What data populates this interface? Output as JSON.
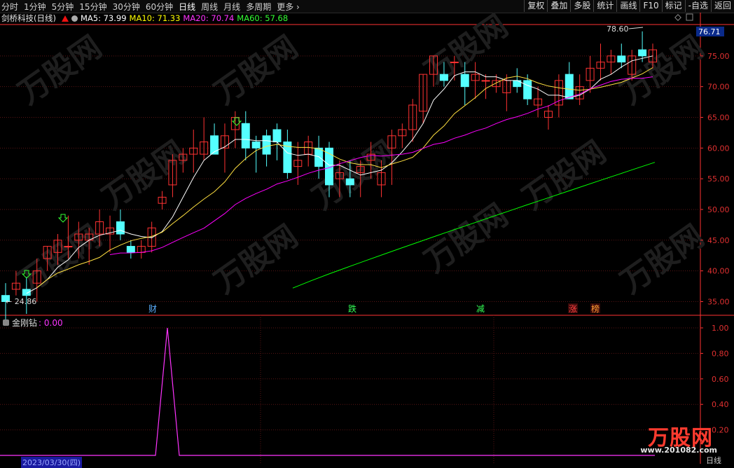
{
  "toolbar": {
    "periods": [
      "分时",
      "1分钟",
      "5分钟",
      "15分钟",
      "30分钟",
      "60分钟",
      "日线",
      "周线",
      "月线",
      "多周期",
      "更多"
    ],
    "active_period": "日线",
    "right_buttons": [
      "复权",
      "叠加",
      "多股",
      "统计",
      "画线",
      "F10",
      "标记",
      "-自选",
      "返回"
    ]
  },
  "stock": {
    "name": "剑桥科技(日线)",
    "ma5": "MA5: 73.99",
    "ma10": "MA10: 71.33",
    "ma20": "MA20: 70.74",
    "ma60": "MA60: 57.68"
  },
  "colors": {
    "up": "#ff3232",
    "down": "#54ffff",
    "ma5": "#ffffff",
    "ma10": "#ffff00",
    "ma20": "#ff00ff",
    "ma60": "#00ff00",
    "axis": "#ff3232",
    "grid": "#5a1414"
  },
  "price_axis": {
    "ticks": [
      "75.00",
      "70.00",
      "65.00",
      "60.00",
      "55.00",
      "50.00",
      "45.00",
      "40.00",
      "35.00"
    ],
    "current": "76.71"
  },
  "annotations": {
    "high": "78.60",
    "low": "24.86",
    "events": [
      "财",
      "跌",
      "减",
      "涨",
      "榜"
    ]
  },
  "indicator": {
    "name": "金刚钻",
    "value": ": 0.00",
    "ticks": [
      "1.00",
      "0.80",
      "0.60",
      "0.40",
      "0.20"
    ]
  },
  "footer": {
    "date": "2023/03/30(四)",
    "right": "日线"
  },
  "watermark": {
    "brand": "万股网",
    "url": "www.201082.com"
  },
  "chart_data": {
    "type": "candlestick",
    "ylim": [
      33,
      80
    ],
    "candles": [
      [
        36,
        38,
        32,
        35
      ],
      [
        37,
        40,
        36,
        38
      ],
      [
        37,
        39,
        33,
        36
      ],
      [
        38,
        42,
        35,
        40
      ],
      [
        42,
        44,
        40,
        44
      ],
      [
        43,
        46,
        41,
        45
      ],
      [
        44,
        49,
        42,
        44
      ],
      [
        45,
        48,
        42,
        46
      ],
      [
        45,
        47,
        41,
        46
      ],
      [
        46,
        50,
        44,
        48
      ],
      [
        46,
        49,
        43,
        47
      ],
      [
        48,
        50,
        45,
        46
      ],
      [
        44,
        45,
        42,
        43
      ],
      [
        43,
        45,
        42,
        44
      ],
      [
        44,
        48,
        43,
        47
      ],
      [
        51,
        53,
        50,
        52
      ],
      [
        54,
        59,
        52,
        58
      ],
      [
        58,
        60,
        56,
        59
      ],
      [
        59,
        63,
        56,
        60
      ],
      [
        59,
        65,
        58,
        61
      ],
      [
        62,
        64,
        59,
        59
      ],
      [
        60,
        64,
        56,
        62
      ],
      [
        63,
        66,
        60,
        65
      ],
      [
        64,
        66,
        58,
        60
      ],
      [
        61,
        62,
        56,
        60
      ],
      [
        62,
        63,
        57,
        59
      ],
      [
        63,
        64,
        58,
        61
      ],
      [
        61,
        63,
        55,
        56
      ],
      [
        57,
        61,
        54,
        58
      ],
      [
        59,
        62,
        57,
        61
      ],
      [
        60,
        62,
        55,
        57
      ],
      [
        60,
        61,
        52,
        54
      ],
      [
        55,
        58,
        52,
        56
      ],
      [
        55,
        58,
        52,
        54
      ],
      [
        56,
        58,
        52,
        57
      ],
      [
        58,
        61,
        55,
        59
      ],
      [
        54,
        58,
        52,
        56
      ],
      [
        60,
        63,
        54,
        62
      ],
      [
        62,
        64,
        60,
        63
      ],
      [
        63,
        68,
        61,
        67
      ],
      [
        66,
        72,
        64,
        72
      ],
      [
        72,
        75,
        70,
        75
      ],
      [
        72,
        74,
        70,
        71
      ],
      [
        74,
        75,
        71,
        74
      ],
      [
        72,
        74,
        67,
        70
      ],
      [
        71,
        74,
        68,
        72
      ],
      [
        71,
        72,
        68,
        71
      ],
      [
        70,
        72,
        69,
        71
      ],
      [
        69,
        72,
        66,
        71
      ],
      [
        71,
        73,
        69,
        70
      ],
      [
        71,
        72,
        67,
        68
      ],
      [
        67,
        70,
        65,
        68
      ],
      [
        65,
        67,
        63,
        66
      ],
      [
        67,
        72,
        65,
        71
      ],
      [
        72,
        74,
        68,
        68
      ],
      [
        68,
        72,
        67,
        70
      ],
      [
        71,
        75,
        69,
        73
      ],
      [
        73,
        77,
        71,
        74
      ],
      [
        74,
        76,
        72,
        75
      ],
      [
        75,
        77,
        73,
        74
      ],
      [
        72,
        76,
        71,
        75
      ],
      [
        76,
        79,
        74,
        75
      ],
      [
        74,
        77,
        73,
        76
      ]
    ],
    "ma60_start": 37.2,
    "ma60_end": 57.68
  }
}
